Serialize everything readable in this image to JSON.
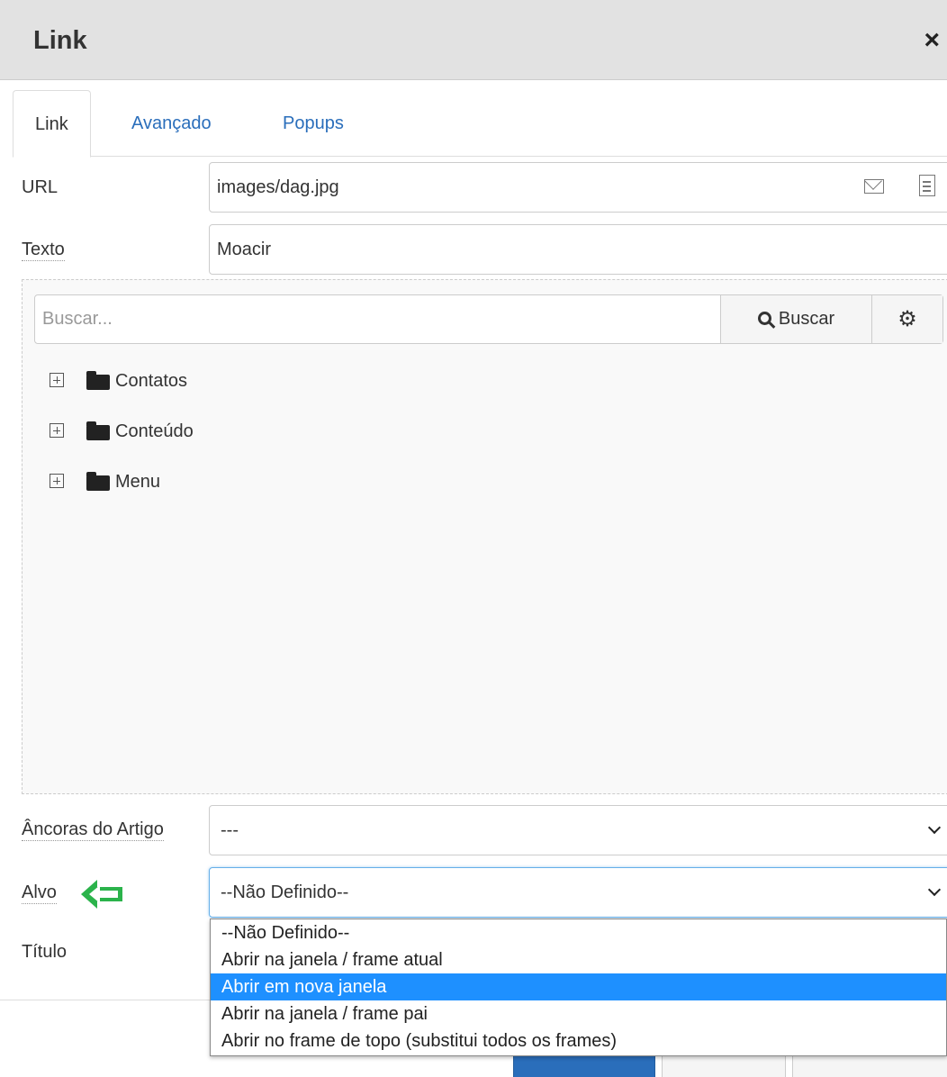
{
  "dialog": {
    "title": "Link",
    "close": "×"
  },
  "tabs": [
    {
      "label": "Link"
    },
    {
      "label": "Avançado"
    },
    {
      "label": "Popups"
    }
  ],
  "url": {
    "label": "URL",
    "value": "images/dag.jpg"
  },
  "texto": {
    "label": "Texto",
    "value": "Moacir"
  },
  "browser": {
    "search_placeholder": "Buscar...",
    "search_button": "Buscar",
    "tree": [
      {
        "label": "Contatos"
      },
      {
        "label": "Conteúdo"
      },
      {
        "label": "Menu"
      }
    ]
  },
  "anchors": {
    "label": "Âncoras do Artigo",
    "value": "---"
  },
  "target": {
    "label": "Alvo",
    "value": "--Não Definido--",
    "options": [
      "--Não Definido--",
      "Abrir na janela / frame atual",
      "Abrir em nova janela",
      "Abrir na janela / frame pai",
      "Abrir no frame de topo (substitui todos os frames)"
    ],
    "highlighted_index": 2,
    "highlight_color": "#1e90ff"
  },
  "title_field": {
    "label": "Título"
  },
  "colors": {
    "link": "#2a6ebb",
    "arrow": "#2bb34b"
  }
}
